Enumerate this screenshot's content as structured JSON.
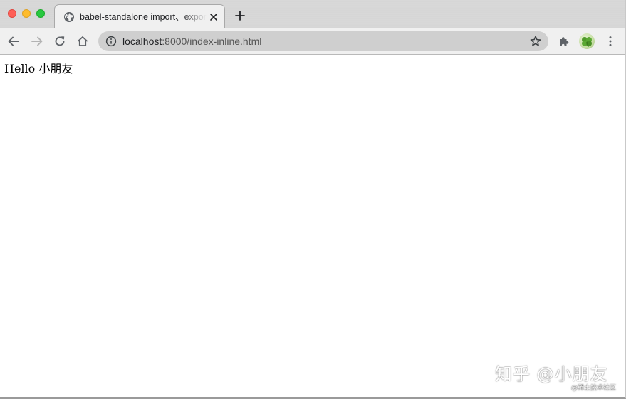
{
  "window": {
    "controls": {
      "close": "traffic-light-red",
      "minimize": "traffic-light-yellow",
      "zoom": "traffic-light-green"
    }
  },
  "tab": {
    "title": "babel-standalone import、export",
    "favicon": "globe-icon",
    "close_icon": "close-icon"
  },
  "toolbar": {
    "back_icon": "arrow-left-icon",
    "forward_icon": "arrow-right-icon",
    "reload_icon": "reload-icon",
    "home_icon": "home-icon",
    "extensions_icon": "puzzle-icon",
    "menu_icon": "kebab-menu-icon"
  },
  "omnibox": {
    "host": "localhost",
    "path": ":8000/index-inline.html",
    "info_icon": "info-icon",
    "bookmark_icon": "star-icon"
  },
  "page": {
    "text": "Hello 小朋友"
  },
  "watermark": {
    "main": "知乎 @小朋友",
    "sub": "@稀土技术社区"
  },
  "colors": {
    "close": "#fe5f57",
    "minimize": "#febc2e",
    "zoom": "#28c840",
    "toolbar_bg": "#f0f0f0",
    "omnibox_bg": "#cfcfcf"
  }
}
